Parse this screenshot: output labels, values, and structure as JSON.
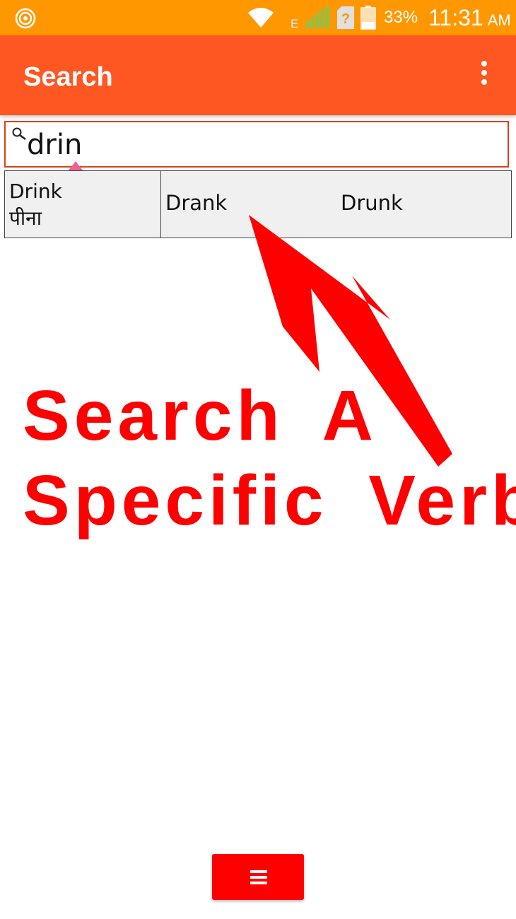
{
  "status_bar": {
    "network_type": "E",
    "battery_percent": "33%",
    "time": "11:31",
    "ampm": "AM",
    "icons": [
      "app-notification-icon",
      "wifi-icon",
      "signal-icon",
      "sim-unknown-icon",
      "battery-icon"
    ]
  },
  "app_bar": {
    "title": "Search",
    "menu_icon": "overflow-menu-icon"
  },
  "search": {
    "value": "drin",
    "icon": "search-icon"
  },
  "results": [
    {
      "base": "Drink",
      "base_hindi": "पीना",
      "past": "Drank",
      "past_participle": "Drunk"
    }
  ],
  "annotation": {
    "line1": "Search  A",
    "line2": "Specific  Verb",
    "color": "#ff0000"
  },
  "bottom_button": {
    "icon": "hamburger-menu-icon",
    "color": "#ff0000"
  },
  "colors": {
    "status_bar": "#ff9800",
    "app_bar": "#ff5722",
    "search_border": "#d84315",
    "cursor_handle": "#f06292"
  }
}
